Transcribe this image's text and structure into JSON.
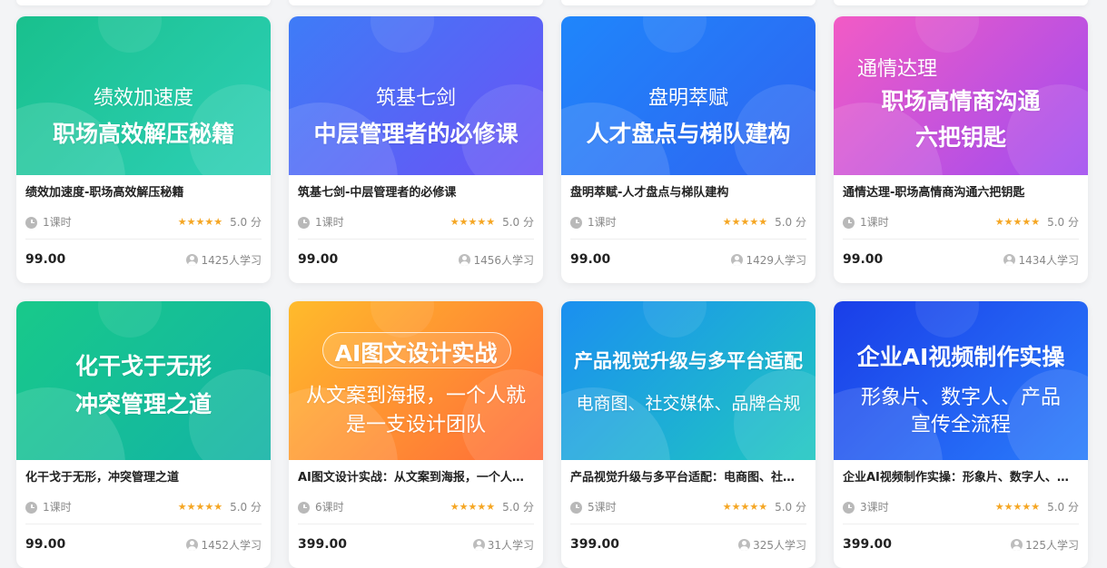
{
  "courses": [
    {
      "banner_lines": [
        "绩效加速度",
        "职场高效解压秘籍"
      ],
      "gradient": [
        "#19c08d",
        "#2ed0b7"
      ],
      "title": "绩效加速度-职场高效解压秘籍",
      "lessons": "1课时",
      "stars": "★★★★★",
      "score": "5.0 分",
      "price": "99.00",
      "learners": "1425人学习"
    },
    {
      "banner_lines": [
        "筑基七剑",
        "中层管理者的必修课"
      ],
      "gradient": [
        "#3e7cf7",
        "#6b52f5"
      ],
      "title": "筑基七剑-中层管理者的必修课",
      "lessons": "1课时",
      "stars": "★★★★★",
      "score": "5.0 分",
      "price": "99.00",
      "learners": "1456人学习"
    },
    {
      "banner_lines": [
        "盘明萃赋",
        "人才盘点与梯队建构"
      ],
      "gradient": [
        "#1f86fb",
        "#2f64f1"
      ],
      "title": "盘明萃赋-人才盘点与梯队建构",
      "lessons": "1课时",
      "stars": "★★★★★",
      "score": "5.0 分",
      "price": "99.00",
      "learners": "1429人学习"
    },
    {
      "banner_lines": [
        "通情达理",
        "职场高情商沟通",
        "六把钥匙"
      ],
      "gradient": [
        "#f25bc5",
        "#a04cf0"
      ],
      "title": "通情达理-职场高情商沟通六把钥匙",
      "lessons": "1课时",
      "stars": "★★★★★",
      "score": "5.0 分",
      "price": "99.00",
      "learners": "1434人学习"
    },
    {
      "banner_lines": [
        "化干戈于无形",
        "冲突管理之道"
      ],
      "gradient": [
        "#18c98a",
        "#13b3a5"
      ],
      "title": "化干戈于无形，冲突管理之道",
      "lessons": "1课时",
      "stars": "★★★★★",
      "score": "5.0 分",
      "price": "99.00",
      "learners": "1452人学习"
    },
    {
      "banner_lines": [
        "AI图文设计实战",
        "从文案到海报，一个人就",
        "是一支设计团队"
      ],
      "gradient": [
        "#ffbb2b",
        "#ff6a39"
      ],
      "title": "AI图文设计实战：从文案到海报，一个人就是一支设计团队",
      "lessons": "6课时",
      "stars": "★★★★★",
      "score": "5.0 分",
      "price": "399.00",
      "learners": "31人学习"
    },
    {
      "banner_lines": [
        "产品视觉升级与多平台适配",
        "电商图、社交媒体、品牌合规"
      ],
      "gradient": [
        "#1b8ff0",
        "#1fc7c0"
      ],
      "title": "产品视觉升级与多平台适配：电商图、社交媒体、品牌合规",
      "lessons": "5课时",
      "stars": "★★★★★",
      "score": "5.0 分",
      "price": "399.00",
      "learners": "325人学习"
    },
    {
      "banner_lines": [
        "企业AI视频制作实操",
        "形象片、数字人、产品",
        "宣传全流程"
      ],
      "gradient": [
        "#1a3ee8",
        "#2a7dfb"
      ],
      "title": "企业AI视频制作实操：形象片、数字人、产品宣传全流程",
      "lessons": "3课时",
      "stars": "★★★★★",
      "score": "5.0 分",
      "price": "399.00",
      "learners": "125人学习"
    }
  ]
}
